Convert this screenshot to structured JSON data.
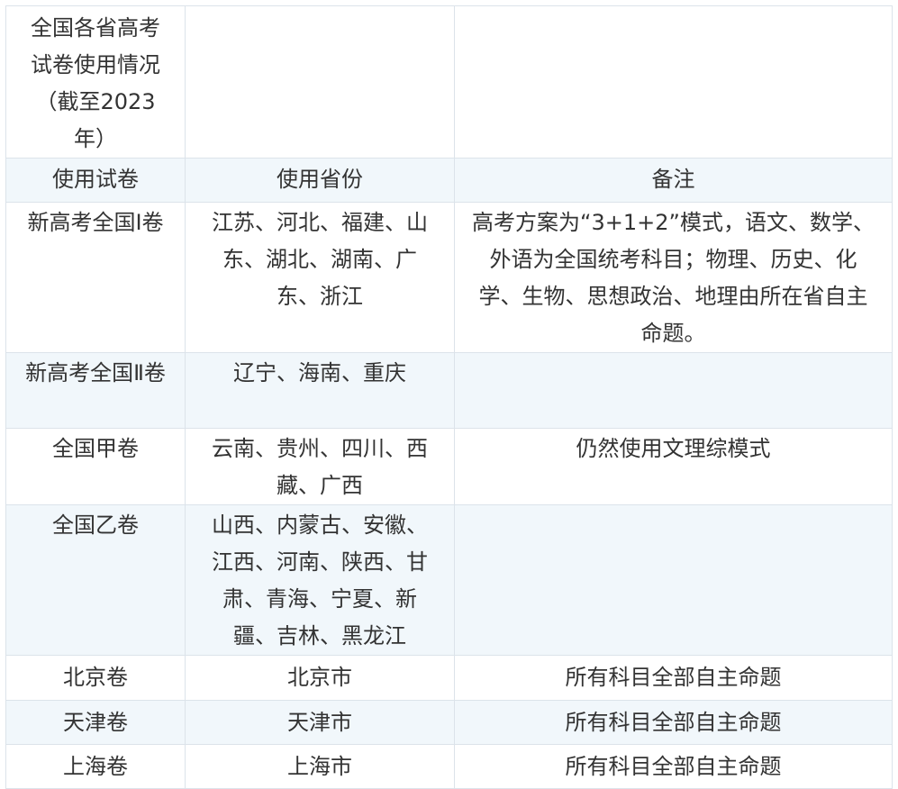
{
  "table": {
    "title": "全国各省高考试卷使用情况（截至2023年）",
    "headers": [
      "使用试卷",
      "使用省份",
      "备注"
    ],
    "rows": [
      [
        "新高考全国Ⅰ卷",
        "江苏、河北、福建、山东、湖北、湖南、广东、浙江",
        "高考方案为“3+1+2”模式，语文、数学、外语为全国统考科目；物理、历史、化学、生物、思想政治、地理由所在省自主命题。"
      ],
      [
        "新高考全国Ⅱ卷",
        "辽宁、海南、重庆",
        ""
      ],
      [
        "全国甲卷",
        "云南、贵州、四川、西藏、广西",
        "仍然使用文理综模式"
      ],
      [
        "全国乙卷",
        "山西、内蒙古、安徽、江西、河南、陕西、甘肃、青海、宁夏、新疆、吉林、黑龙江",
        ""
      ],
      [
        "北京卷",
        "北京市",
        "所有科目全部自主命题"
      ],
      [
        "天津卷",
        "天津市",
        "所有科目全部自主命题"
      ],
      [
        "上海卷",
        "上海市",
        "所有科目全部自主命题"
      ]
    ]
  }
}
